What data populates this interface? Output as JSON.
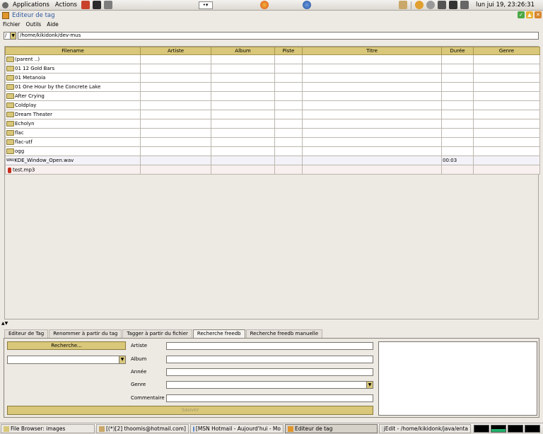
{
  "top_panel": {
    "menus": [
      "Applications",
      "Actions"
    ],
    "clock": "lun jui 19, 23:26:31"
  },
  "window": {
    "title": "Editeur de tag"
  },
  "menubar": [
    "Fichier",
    "Outils",
    "Aide"
  ],
  "path": {
    "root": "/",
    "current": "/home/kikidonk/dev-mus"
  },
  "table": {
    "columns": [
      "Filename",
      "Artiste",
      "Album",
      "Piste",
      "Titre",
      "Durée",
      "Genre"
    ],
    "rows": [
      {
        "type": "folder",
        "filename": "(parent ..)",
        "artiste": "",
        "album": "",
        "piste": "",
        "titre": "",
        "duree": "",
        "genre": ""
      },
      {
        "type": "folder",
        "filename": "01 12 Gold Bars",
        "artiste": "",
        "album": "",
        "piste": "",
        "titre": "",
        "duree": "",
        "genre": ""
      },
      {
        "type": "folder",
        "filename": "01 Metanoia",
        "artiste": "",
        "album": "",
        "piste": "",
        "titre": "",
        "duree": "",
        "genre": ""
      },
      {
        "type": "folder",
        "filename": "01 One Hour by the Concrete Lake",
        "artiste": "",
        "album": "",
        "piste": "",
        "titre": "",
        "duree": "",
        "genre": ""
      },
      {
        "type": "folder",
        "filename": "After Crying",
        "artiste": "",
        "album": "",
        "piste": "",
        "titre": "",
        "duree": "",
        "genre": ""
      },
      {
        "type": "folder",
        "filename": "Coldplay",
        "artiste": "",
        "album": "",
        "piste": "",
        "titre": "",
        "duree": "",
        "genre": ""
      },
      {
        "type": "folder",
        "filename": "Dream Theater",
        "artiste": "",
        "album": "",
        "piste": "",
        "titre": "",
        "duree": "",
        "genre": ""
      },
      {
        "type": "folder",
        "filename": "Echolyn",
        "artiste": "",
        "album": "",
        "piste": "",
        "titre": "",
        "duree": "",
        "genre": ""
      },
      {
        "type": "folder",
        "filename": "flac",
        "artiste": "",
        "album": "",
        "piste": "",
        "titre": "",
        "duree": "",
        "genre": ""
      },
      {
        "type": "folder",
        "filename": "flac-utf",
        "artiste": "",
        "album": "",
        "piste": "",
        "titre": "",
        "duree": "",
        "genre": ""
      },
      {
        "type": "folder",
        "filename": "ogg",
        "artiste": "",
        "album": "",
        "piste": "",
        "titre": "",
        "duree": "",
        "genre": ""
      },
      {
        "type": "wav",
        "filename": "KDE_Window_Open.wav",
        "artiste": "",
        "album": "",
        "piste": "",
        "titre": "",
        "duree": "00:03",
        "genre": ""
      },
      {
        "type": "mp3",
        "filename": "test.mp3",
        "artiste": "",
        "album": "",
        "piste": "",
        "titre": "",
        "duree": "",
        "genre": ""
      }
    ],
    "wav_icon_text": "WAV"
  },
  "tabs": [
    "Editeur de Tag",
    "Renommer à partir du tag",
    "Tagger à partir du fichier",
    "Recherche freedb",
    "Recherche freedb manuelle"
  ],
  "active_tab": 3,
  "freedb": {
    "search_label": "Recherche...",
    "fields": [
      "Artiste",
      "Album",
      "Année",
      "Genre",
      "Commentaire"
    ],
    "save_label": "Sauver"
  },
  "taskbar": {
    "items": [
      "File Browser: images",
      "[(*)[2] thoomis@hotmail.com]",
      "[MSN Hotmail - Aujourd'hui - Mo",
      "Editeur de tag",
      "jEdit - /home/kikidonk/java/enta"
    ],
    "active_index": 3
  },
  "colors": {
    "accent": "#d9c77a",
    "title_text": "#2c5aa0",
    "panel_bg": "#ede9e3"
  }
}
